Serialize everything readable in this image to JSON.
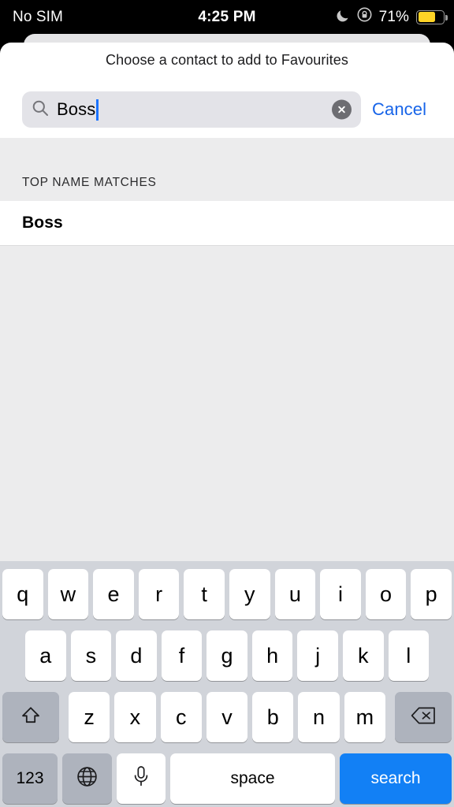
{
  "status_bar": {
    "carrier": "No SIM",
    "time": "4:25 PM",
    "dnd_icon": "moon-icon",
    "rotation_lock_icon": "rotation-lock-icon",
    "battery_percent": "71%",
    "battery_level": 71,
    "battery_color": "#ffd426"
  },
  "sheet": {
    "title": "Choose a contact to add to Favourites"
  },
  "search": {
    "icon": "search-icon",
    "value": "Boss",
    "placeholder": "Search",
    "clear_icon": "clear-circle-icon",
    "cancel_label": "Cancel",
    "accent_color": "#1764e8"
  },
  "list": {
    "section_header": "TOP NAME MATCHES",
    "rows": [
      {
        "name": "Boss"
      }
    ]
  },
  "keyboard": {
    "row1": [
      "q",
      "w",
      "e",
      "r",
      "t",
      "y",
      "u",
      "i",
      "o",
      "p"
    ],
    "row2": [
      "a",
      "s",
      "d",
      "f",
      "g",
      "h",
      "j",
      "k",
      "l"
    ],
    "row3": [
      "z",
      "x",
      "c",
      "v",
      "b",
      "n",
      "m"
    ],
    "shift_icon": "shift-icon",
    "backspace_icon": "backspace-icon",
    "numbers_label": "123",
    "globe_icon": "globe-icon",
    "mic_icon": "microphone-icon",
    "space_label": "space",
    "return_label": "search",
    "return_color": "#1280f5"
  }
}
